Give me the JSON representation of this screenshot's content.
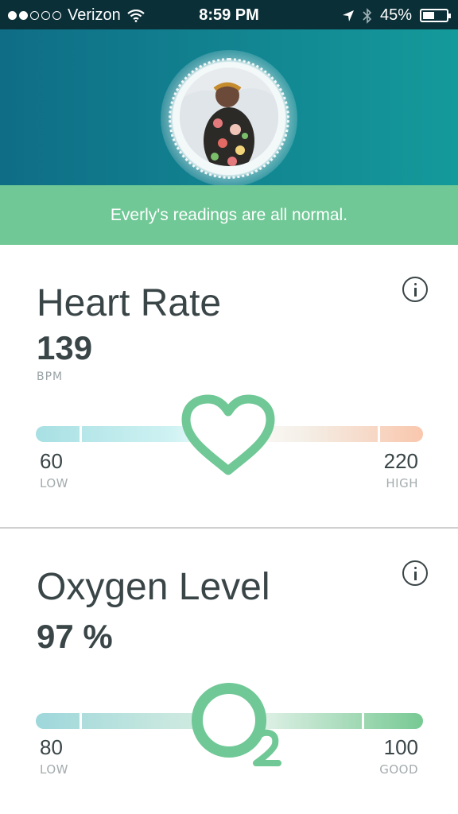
{
  "status_bar": {
    "carrier": "Verizon",
    "time": "8:59 PM",
    "battery": "45%",
    "signal_dots_filled": 2,
    "signal_dots_total": 5,
    "icons": [
      "wifi-icon",
      "location-arrow-icon",
      "bluetooth-icon",
      "battery-icon"
    ]
  },
  "banner": {
    "message": "Everly's readings are all normal."
  },
  "heart_rate": {
    "title": "Heart Rate",
    "value": "139",
    "unit": "BPM",
    "low_value": "60",
    "low_label": "LOW",
    "high_value": "220",
    "high_label": "HIGH",
    "icon": "heart-icon"
  },
  "oxygen": {
    "title": "Oxygen Level",
    "value": "97 %",
    "low_value": "80",
    "low_label": "LOW",
    "high_value": "100",
    "high_label": "GOOD",
    "icon": "o2-icon"
  },
  "colors": {
    "hero_start": "#0f6d86",
    "hero_end": "#149a9b",
    "banner": "#6fc895",
    "accent": "#6fc895",
    "text": "#3a4547"
  }
}
